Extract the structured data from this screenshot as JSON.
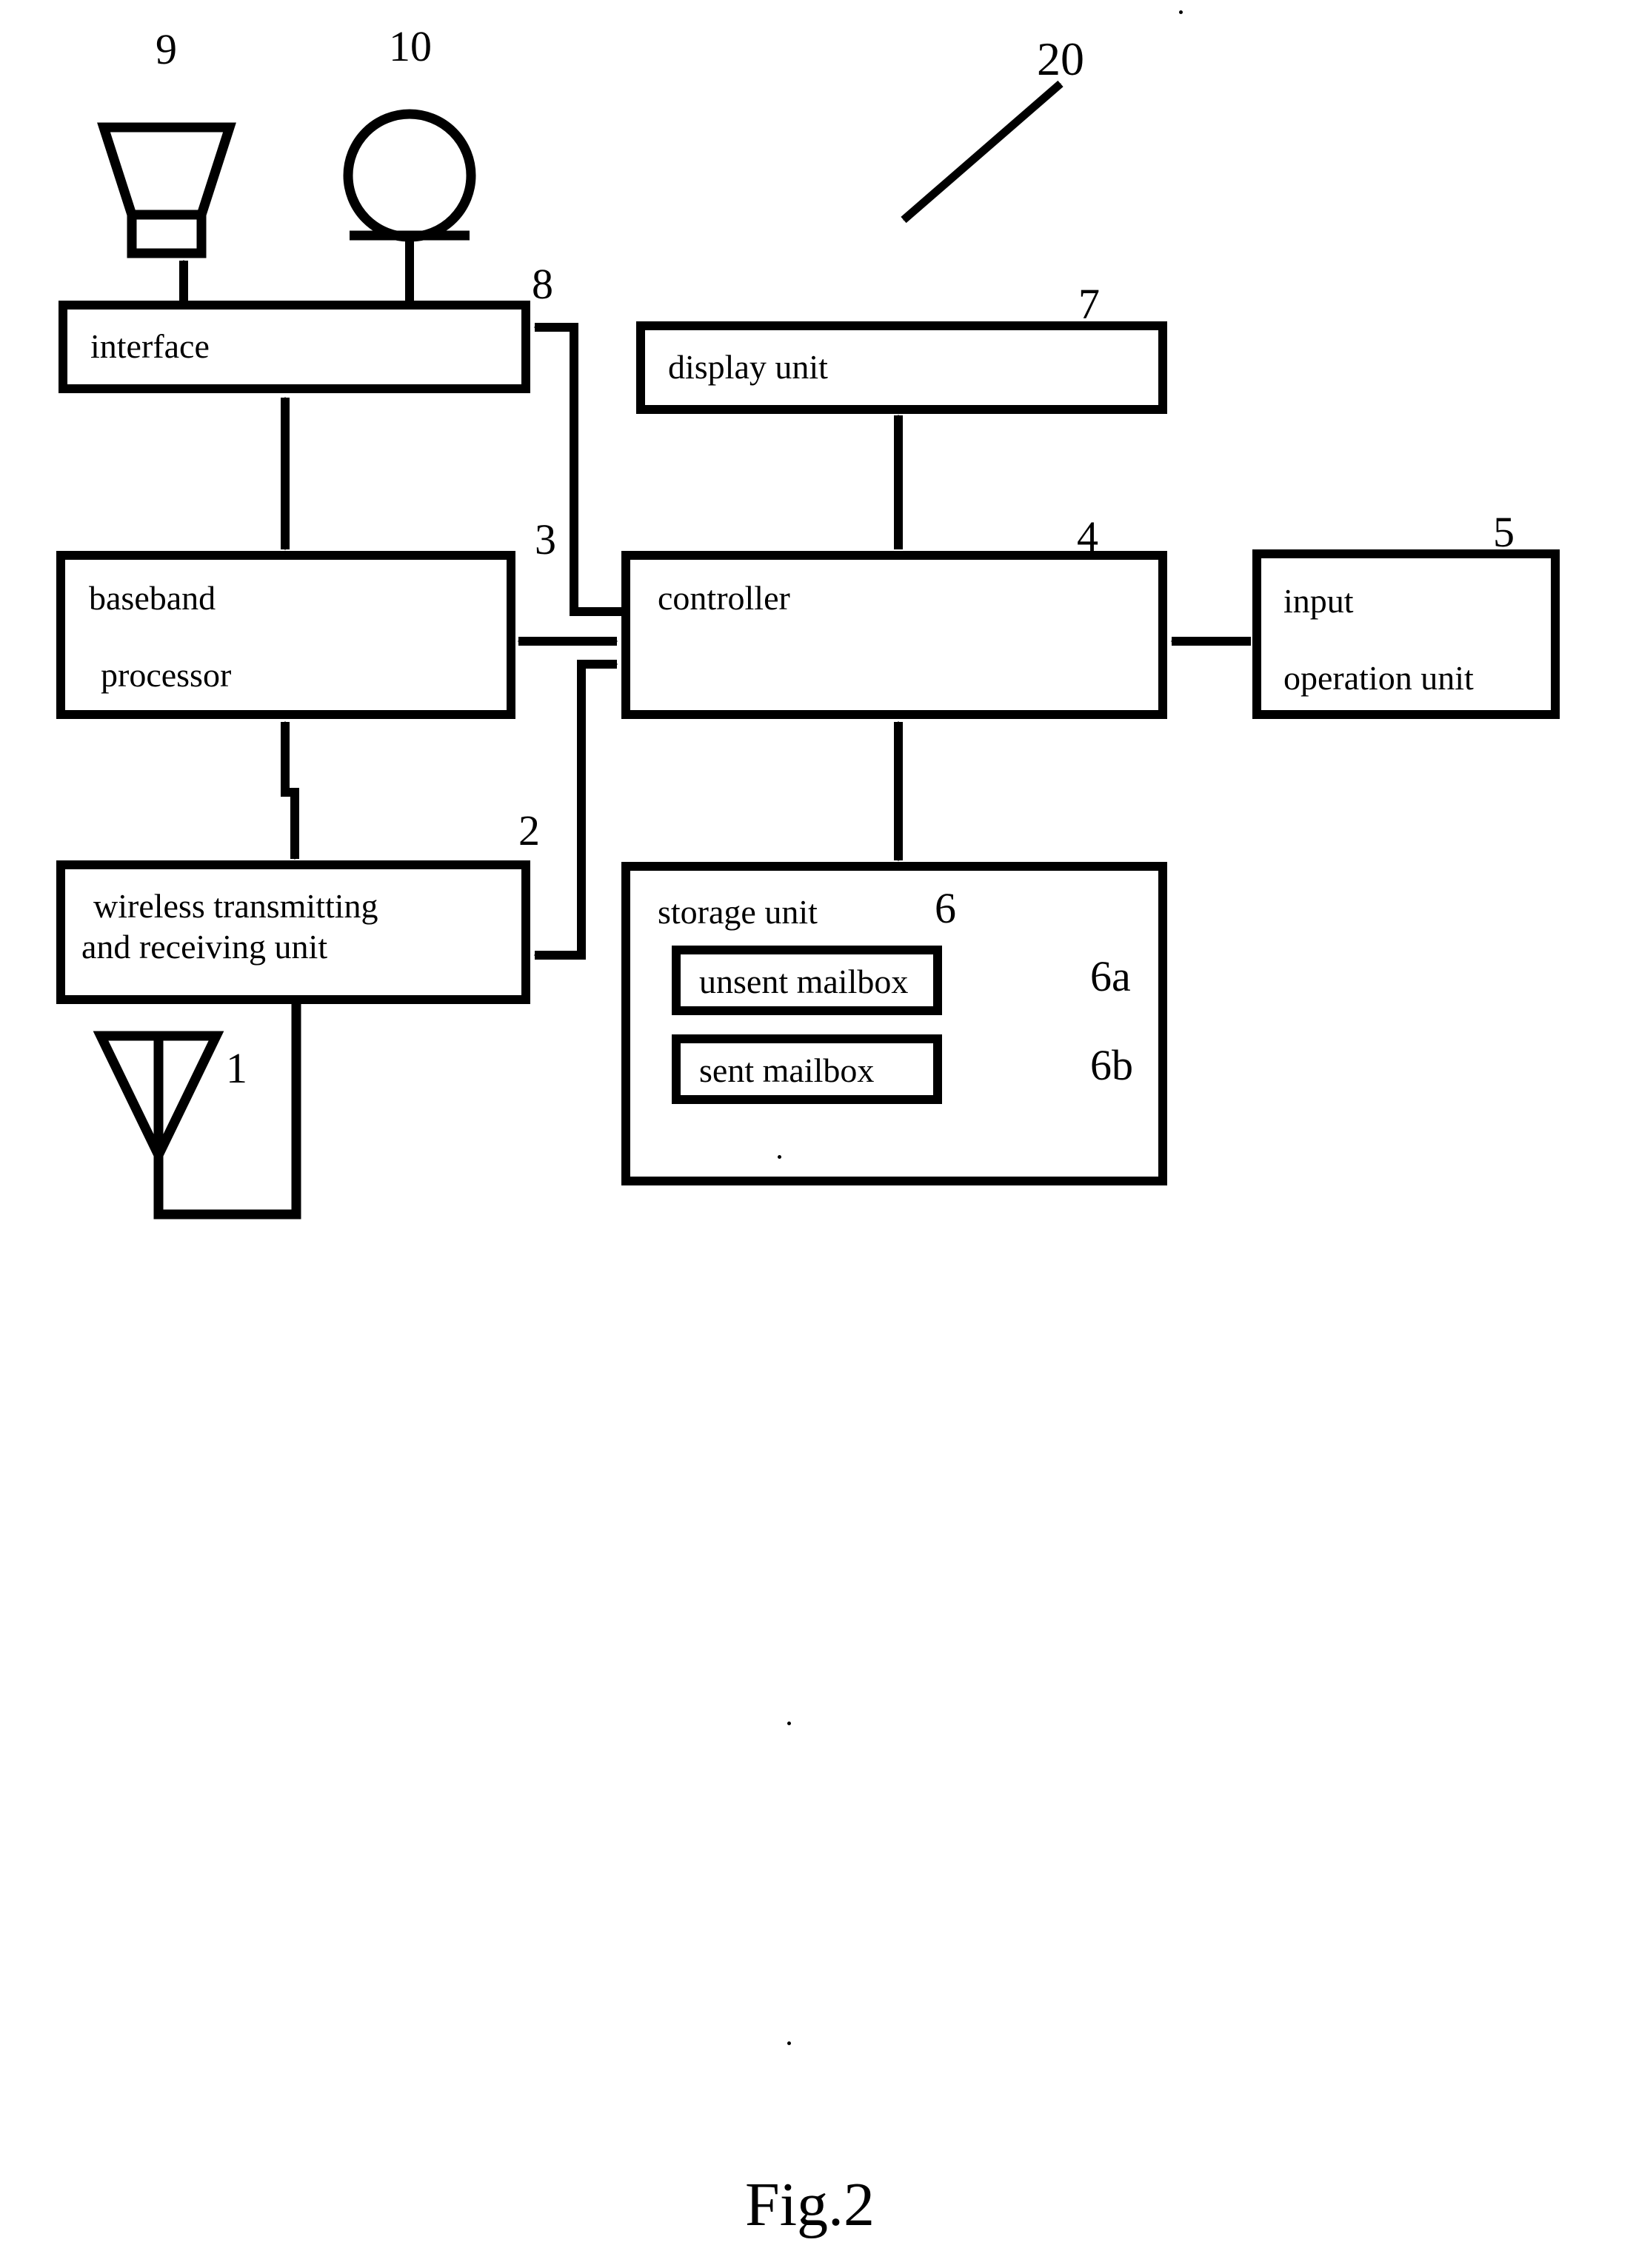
{
  "figure": {
    "caption": "Fig.2",
    "system_ref": "20"
  },
  "blocks": [
    {
      "id": "interface",
      "label": "interface",
      "ref": "8"
    },
    {
      "id": "display",
      "label": "display unit",
      "ref": "7"
    },
    {
      "id": "baseband",
      "label_line1": "baseband",
      "label_line2": "processor",
      "ref": "3"
    },
    {
      "id": "controller",
      "label": "controller",
      "ref": "4"
    },
    {
      "id": "input",
      "label_line1": "input",
      "label_line2": "operation unit",
      "ref": "5"
    },
    {
      "id": "wireless",
      "label_line1": "wireless transmitting",
      "label_line2": "and receiving unit",
      "ref": "2"
    },
    {
      "id": "storage",
      "label": "storage unit",
      "ref": "6"
    },
    {
      "id": "unsent_mailbox",
      "label": "unsent mailbox",
      "ref": "6a"
    },
    {
      "id": "sent_mailbox",
      "label": "sent mailbox",
      "ref": "6b"
    }
  ],
  "symbols": [
    {
      "id": "speaker",
      "icon": "speaker-icon",
      "ref": "9"
    },
    {
      "id": "microphone",
      "icon": "microphone-icon",
      "ref": "10"
    },
    {
      "id": "antenna",
      "icon": "antenna-icon",
      "ref": "1"
    }
  ],
  "colors": {
    "stroke": "#000000",
    "background": "#ffffff"
  }
}
